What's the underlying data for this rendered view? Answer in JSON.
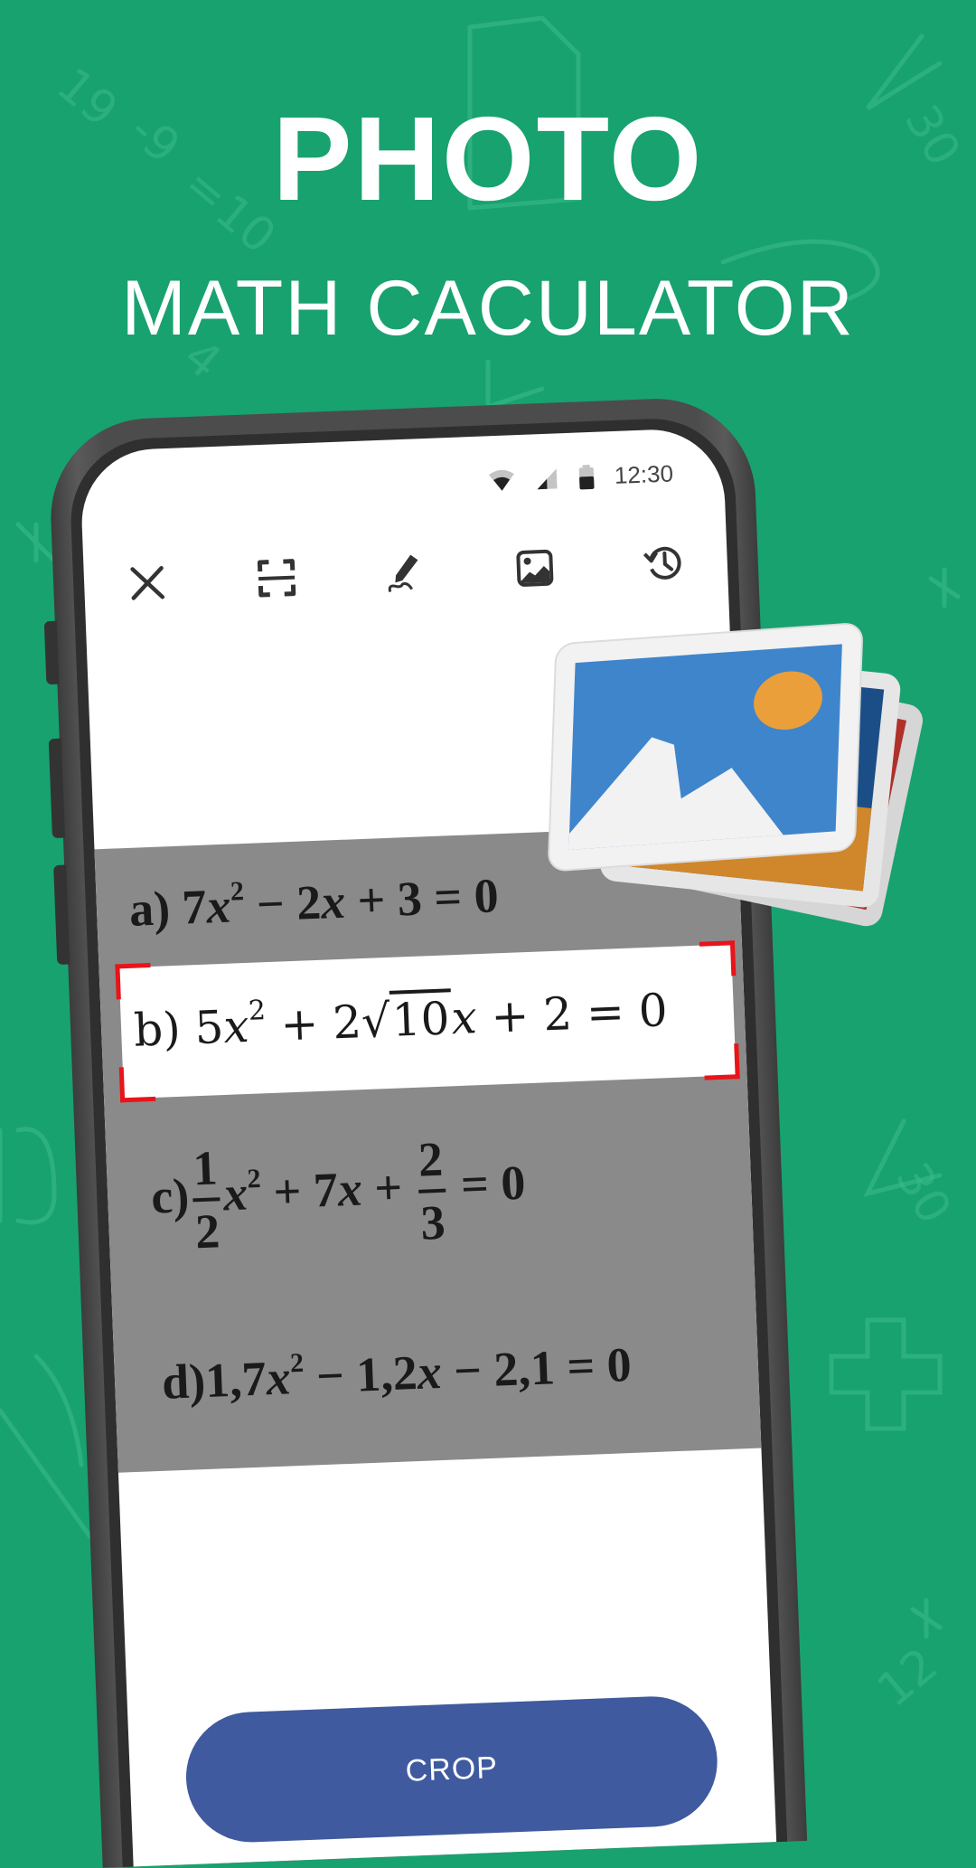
{
  "hero": {
    "title": "PHOTO",
    "subtitle": "MATH CACULATOR"
  },
  "status_bar": {
    "time": "12:30",
    "icons": [
      "wifi-icon",
      "signal-icon",
      "battery-icon"
    ]
  },
  "toolbar": {
    "items": [
      {
        "name": "close",
        "icon": "close-icon"
      },
      {
        "name": "scan",
        "icon": "scan-frame-icon"
      },
      {
        "name": "handwriting",
        "icon": "pen-icon"
      },
      {
        "name": "gallery",
        "icon": "image-icon"
      },
      {
        "name": "history",
        "icon": "history-icon"
      }
    ]
  },
  "equations": {
    "a": {
      "label": "a)",
      "text": "7x² − 2x + 3 = 0"
    },
    "b": {
      "label": "b)",
      "text": "5x² + 2√10x + 2 = 0"
    },
    "c": {
      "label": "c)",
      "text": "1/2 x² + 7x + 2/3 = 0"
    },
    "d": {
      "label": "d)",
      "text": "1,7x² − 1,2x − 2,1 = 0"
    }
  },
  "equation_parts": {
    "a_coef1": "7",
    "a_var": "x",
    "a_exp": "2",
    "a_rest1": " − 2",
    "a_var2": "x",
    "a_rest2": " + 3 = 0",
    "b_coef1": "5",
    "b_var": "x",
    "b_exp": "2",
    "b_rest1": " + 2√",
    "b_rad": "10",
    "b_var2": "x",
    "b_rest2": " + 2 = 0",
    "c_num1": "1",
    "c_den1": "2",
    "c_var": "x",
    "c_exp": "2",
    "c_rest1": " + 7",
    "c_var2": "x",
    "c_rest2": " + ",
    "c_num2": "2",
    "c_den2": "3",
    "c_rest3": " = 0",
    "d_coef1": "1,7",
    "d_var": "x",
    "d_exp": "2",
    "d_rest1": " − 1,2",
    "d_var2": "x",
    "d_rest2": " − 2,1 = 0"
  },
  "selected_equation": "b",
  "crop_button": {
    "label": "CROP"
  },
  "colors": {
    "background": "#18A270",
    "button": "#3F5A9E",
    "crop_handles": "#E8141A",
    "photo_area": "#8A8A8A"
  }
}
